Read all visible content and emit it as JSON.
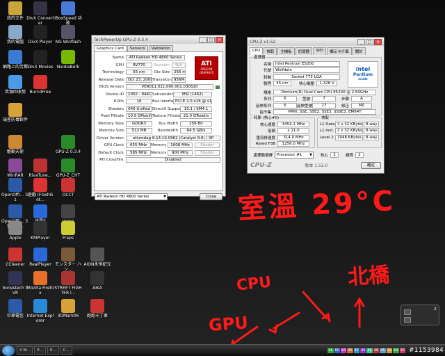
{
  "desktop_icons": [
    {
      "label": "我的文件",
      "color": "#c9a43b"
    },
    {
      "label": "DivX Converter",
      "color": "#334"
    },
    {
      "label": "iBoxSpeed 功能",
      "color": "#4a7ad8"
    },
    {
      "label": "我的電腦",
      "color": "#8aa8c8"
    },
    {
      "label": "DivX Player",
      "color": "#222"
    },
    {
      "label": "NG Winflash",
      "color": "#556"
    },
    {
      "label": "網路上的芳鄰",
      "color": "#3a7ad0"
    },
    {
      "label": "DivX Movies",
      "color": "#222"
    },
    {
      "label": "NvidiaBerk",
      "color": "#76b900"
    },
    {
      "label": "資源回收筒",
      "color": "#4d9ae8"
    },
    {
      "label": "Burn4Free",
      "color": "#d33"
    },
    {
      "label": "瑞星防毒軟件",
      "color": "#d8a23a"
    },
    {
      "label": "驅動天使",
      "color": "#c83"
    },
    {
      "label": "GPU-Z 0.3.4",
      "color": "#2a8a2a"
    },
    {
      "label": "WinRAR",
      "color": "#8a4a9a"
    },
    {
      "label": "RivaTune...",
      "color": "#b33"
    },
    {
      "label": "GPU-Z_CHT",
      "color": "#2a8a2a"
    },
    {
      "label": "OpenOffi... 3.1",
      "color": "#2a5aa8"
    },
    {
      "label": "遊戲 (FlashGet...",
      "color": "#d33"
    },
    {
      "label": "OCCT",
      "color": "#c33"
    },
    {
      "label": "OpenOffi... 3.1 (zh-T...",
      "color": "#2a5aa8"
    },
    {
      "label": "迅雷5",
      "color": "#2a6ad8"
    },
    {
      "label": "rmms",
      "color": "#444"
    },
    {
      "label": "Apple",
      "color": "#888"
    },
    {
      "label": "KMPlayer",
      "color": "#333"
    },
    {
      "label": "Fraps",
      "color": "#cc3"
    },
    {
      "label": "CCleaner",
      "color": "#c33"
    },
    {
      "label": "RealPlayer",
      "color": "#2a6ad8"
    },
    {
      "label": "モンスター ハン...",
      "color": "#7a5a3a"
    },
    {
      "label": "AION永恒紀元",
      "color": "#555"
    },
    {
      "label": "honestech TVR",
      "color": "#335"
    },
    {
      "label": "Mozilla Firefox",
      "color": "#e8702a"
    },
    {
      "label": "STREET FIGHTER I...",
      "color": "#a33"
    },
    {
      "label": "AIKA",
      "color": "#333"
    },
    {
      "label": "中華電信",
      "color": "#2a5aa8"
    },
    {
      "label": "Internet Explorer",
      "color": "#2a8ad8"
    },
    {
      "label": "3DMark06",
      "color": "#d8a23a"
    },
    {
      "label": "跑跑卡丁車",
      "color": "#c33"
    }
  ],
  "gpuz": {
    "title": "TechPowerUp GPU-Z 0.3.4",
    "tabs": [
      "Graphics Card",
      "Sensors",
      "Validation"
    ],
    "fields": {
      "name": "ATI Radeon HD 4800 Series",
      "gpu": "RV770",
      "revision": "N/A",
      "technology": "55 nm",
      "die_size": "256 mm²",
      "release_date": "Oct 23, 2008",
      "transistors": "956M",
      "bios_version": "VER011.011.000.001.030520",
      "device_id": "1002 - 944C",
      "subvendor": "MSI (1462)",
      "rops": "16",
      "bus_interface": "PCI-E 2.0 x16 @ x16 2.0",
      "shaders": "640 Unified",
      "directx": "10.1 / SM4.1",
      "pixel_fillrate": "10.5 GPixel/s",
      "texture_fillrate": "21.0 GTexel/s",
      "memory_type": "GDDR3",
      "bus_width": "256 Bit",
      "memory_size": "512 MB",
      "bandwidth": "64.5 GB/s",
      "driver_version": "atiumdag 8.14.10.0962 (Catalyst 9.6) / XP",
      "gpu_clock": "655 MHz",
      "gpu_memory": "1008 MHz",
      "gpu_shader": "Shader",
      "default_clock": "585 MHz",
      "default_memory": "900 MHz",
      "default_shader": "Shader",
      "crossfire": "Disabled"
    },
    "labels": {
      "name": "Name",
      "gpu": "GPU",
      "revision": "Revision",
      "technology": "Technology",
      "die_size": "Die Size",
      "release_date": "Release Date",
      "transistors": "Transistors",
      "bios_version": "BIOS Version",
      "device_id": "Device ID",
      "subvendor": "Subvendor",
      "rops": "ROPs",
      "bus_interface": "Bus Interface",
      "shaders": "Shaders",
      "directx": "DirectX Support",
      "pixel_fillrate": "Pixel Fillrate",
      "texture_fillrate": "Texture Fillrate",
      "memory_type": "Memory Type",
      "bus_width": "Bus Width",
      "memory_size": "Memory Size",
      "bandwidth": "Bandwidth",
      "driver_version": "Driver Version",
      "gpu_clock": "GPU Clock",
      "memory": "Memory",
      "default_clock": "Default Clock",
      "crossfire": "ATI CrossFire"
    },
    "ati_logo": {
      "text": "ATI",
      "sub1": "RADEON",
      "sub2": "GRAPHICS"
    },
    "select_value": "ATI Radeon HD 4800 Series",
    "close_label": "Close"
  },
  "cpuz": {
    "title": "CPU-Z v1.52",
    "tabs": [
      "CPU",
      "快取",
      "主機板",
      "記憶體",
      "SPD",
      "顯示卡介面",
      "關於"
    ],
    "processor_group": "處理器",
    "labels": {
      "name": "名稱",
      "code": "代號",
      "package": "封裝",
      "tech": "製程",
      "core_voltage": "核心電壓",
      "spec": "規格",
      "family": "系列",
      "model": "型號",
      "stepping": "步驟",
      "ext_family": "延伸系列",
      "ext_model": "延伸型號",
      "revision": "修正",
      "instructions": "指令集",
      "clocks_group": "時脈 (核心#0)",
      "cache_group": "快取",
      "core_speed": "核心速度",
      "multiplier": "倍頻",
      "bus_speed": "匯流排速度",
      "rated_fsb": "Rated FSB",
      "l1_data": "L1 Data",
      "l1_inst": "L1 Inst.",
      "level2": "Level 2",
      "selection": "處理器選擇",
      "cores": "核心",
      "threads": "線程",
      "version": "版本 1.52.0",
      "ok": "確定",
      "logo": "CPU-Z"
    },
    "values": {
      "name": "Intel Pentium E5200",
      "code": "Wolfdale",
      "package": "Socket 775 LGA",
      "tech": "45 nm",
      "core_voltage": "1.328 V",
      "spec": "Pentium(R) Dual-Core  CPU    E5200  @ 2.50GHz",
      "family": "6",
      "model": "7",
      "stepping": "A",
      "ext_family": "6",
      "ext_model": "17",
      "revision": "M0",
      "instructions": "MMX, SSE, SSE2, SSE3, SSSE3, EM64T",
      "core_speed": "3454.1 MHz",
      "multiplier": "x 11.0",
      "bus_speed": "314.0 MHz",
      "rated_fsb": "1256.0 MHz",
      "l1_data": "2 x 32 KBytes",
      "l1_data_way": "8-way",
      "l1_inst": "2 x 32 KBytes",
      "l1_inst_way": "8-way",
      "level2": "2048 KBytes",
      "level2_way": "8-way",
      "selection": "Processor #1",
      "cores": "2",
      "threads": "2"
    },
    "intel_logo": {
      "text": "intel",
      "sub": "Pentium",
      "sub2": "inside"
    }
  },
  "annotations": {
    "room": "室溫 29°C",
    "cpu": "CPU",
    "gpu": "GPU",
    "north": "北橋"
  },
  "taskbar": {
    "items": [
      "3 W...",
      "E...",
      "E...",
      "C..."
    ],
    "tray_numbers": [
      "56",
      "60",
      "64",
      "45",
      "47",
      "45",
      "45",
      "46",
      "45",
      "33",
      "1B",
      "30"
    ],
    "watermark": "#1153984"
  },
  "gadget": {
    "number": "2"
  }
}
